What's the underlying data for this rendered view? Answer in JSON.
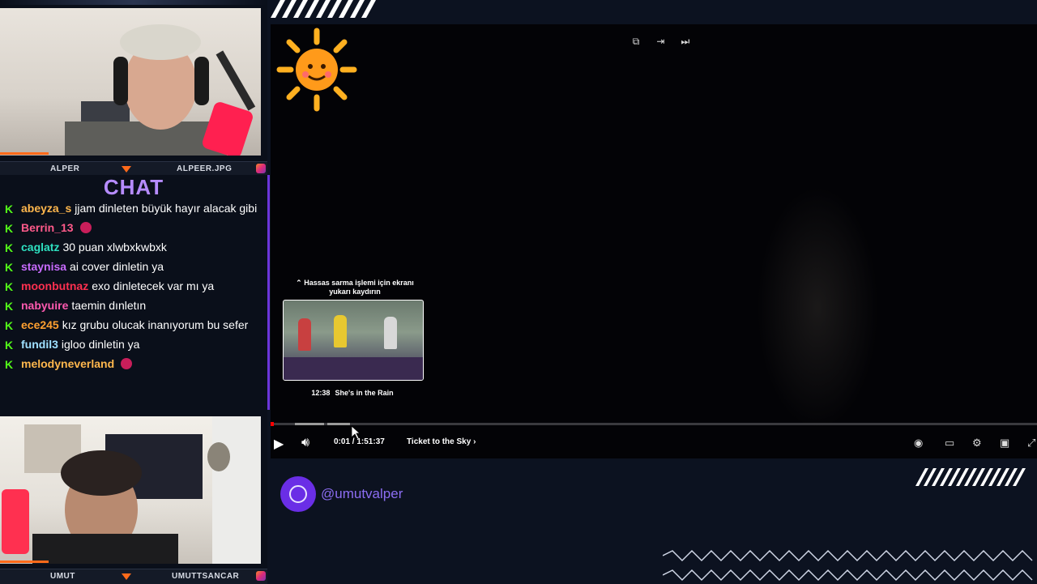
{
  "webcams": {
    "top": {
      "left_label": "ALPER",
      "right_label": "ALPEER.JPG"
    },
    "bottom": {
      "left_label": "UMUT",
      "right_label": "UMUTTSANCAR"
    }
  },
  "chat": {
    "title": "CHAT",
    "messages": [
      {
        "user": "abeyza_s",
        "color": "#ffb74d",
        "text": "jjam dinleten büyük hayır alacak gibi"
      },
      {
        "user": "Berrin_13",
        "color": "#ff5a8a",
        "text": ""
      },
      {
        "user": "caglatz",
        "color": "#2ee0c0",
        "text": "30 puan xlwbxkwbxk"
      },
      {
        "user": "staynisa",
        "color": "#c86bff",
        "text": "ai cover dinletin ya"
      },
      {
        "user": "moonbutnaz",
        "color": "#ff3050",
        "text": "exo dinletecek var mı ya"
      },
      {
        "user": "nabyuire",
        "color": "#ff5ab0",
        "text": "taemin dınletın"
      },
      {
        "user": "ece245",
        "color": "#ffa030",
        "text": "kız grubu olucak inanıyorum bu sefer"
      },
      {
        "user": "fundil3",
        "color": "#9fe0ff",
        "text": "igloo dinletin ya"
      },
      {
        "user": "melodyneverland",
        "color": "#ffb74d",
        "text": ""
      }
    ]
  },
  "player": {
    "hint": "⌃ Hassas sarma işlemi için ekranı yukarı kaydırın",
    "preview_time": "12:38",
    "preview_title": "She's in the Rain",
    "time_display": "0:01 / 1:51:37",
    "chapter": "Ticket to the Sky",
    "progress_fraction": 0.0001
  },
  "social": {
    "handle": "@umutvalper"
  },
  "colors": {
    "accent_purple": "#6b35d9",
    "accent_orange": "#ff6a1a",
    "kick_green": "#53fc18"
  }
}
